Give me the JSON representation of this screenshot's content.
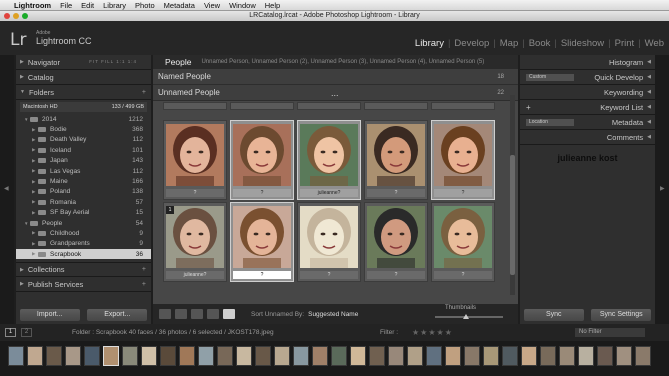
{
  "menubar": {
    "items": [
      "Lightroom",
      "File",
      "Edit",
      "Library",
      "Photo",
      "Metadata",
      "View",
      "Window",
      "Help"
    ]
  },
  "window": {
    "title": "LRCatalog.lrcat - Adobe Photoshop Lightroom - Library"
  },
  "identity": {
    "logo": "Lr",
    "adobe": "Adobe",
    "product": "Lightroom CC"
  },
  "modules": [
    "Library",
    "Develop",
    "Map",
    "Book",
    "Slideshow",
    "Print",
    "Web"
  ],
  "left_panel": {
    "navigator": {
      "label": "Navigator",
      "tools": "FIT FILL 1:1 1:4"
    },
    "catalog": {
      "label": "Catalog"
    },
    "folders": {
      "label": "Folders",
      "actions": "+",
      "volume": {
        "name": "Macintosh HD",
        "space": "133 / 499 GB"
      },
      "items": [
        {
          "name": "2014",
          "count": "1212",
          "depth": 1,
          "open": true
        },
        {
          "name": "Bodie",
          "count": "368",
          "depth": 2
        },
        {
          "name": "Death Valley",
          "count": "112",
          "depth": 2
        },
        {
          "name": "Iceland",
          "count": "101",
          "depth": 2
        },
        {
          "name": "Japan",
          "count": "143",
          "depth": 2
        },
        {
          "name": "Las Vegas",
          "count": "112",
          "depth": 2
        },
        {
          "name": "Maine",
          "count": "166",
          "depth": 2
        },
        {
          "name": "Poland",
          "count": "138",
          "depth": 2
        },
        {
          "name": "Romania",
          "count": "57",
          "depth": 2
        },
        {
          "name": "SF Bay Aerial",
          "count": "15",
          "depth": 2
        },
        {
          "name": "People",
          "count": "54",
          "depth": 1,
          "open": true
        },
        {
          "name": "Childhood",
          "count": "9",
          "depth": 2
        },
        {
          "name": "Grandparents",
          "count": "9",
          "depth": 2
        },
        {
          "name": "Scrapbook",
          "count": "36",
          "depth": 2,
          "selected": true
        }
      ]
    },
    "collections": {
      "label": "Collections",
      "actions": "+"
    },
    "publish": {
      "label": "Publish Services",
      "actions": "+"
    },
    "import_label": "Import...",
    "export_label": "Export..."
  },
  "center": {
    "people_title": "People",
    "people_breadcrumb": "Unnamed Person,  Unnamed Person (2),  Unnamed Person (3),  Unnamed Person (4),  Unnamed Person (5)",
    "named": {
      "label": "Named People",
      "count": "18"
    },
    "unnamed": {
      "label": "Unnamed People",
      "count": "22",
      "dots": "..."
    },
    "row1": [
      {
        "caption": "?",
        "selected": false,
        "palette": [
          "#b27a5e",
          "#5a2f22",
          "#e3b49b"
        ]
      },
      {
        "caption": "?",
        "selected": true,
        "palette": [
          "#a8705a",
          "#6c4a30",
          "#e8b496"
        ]
      },
      {
        "caption": "julieanne?",
        "selected": true,
        "palette": [
          "#5a7a5a",
          "#7a5a3a",
          "#efc4a4"
        ]
      },
      {
        "caption": "?",
        "selected": false,
        "palette": [
          "#aa9070",
          "#3a2a22",
          "#d39a7a"
        ]
      },
      {
        "caption": "?",
        "selected": true,
        "palette": [
          "#a48878",
          "#6a4020",
          "#e8b090"
        ]
      }
    ],
    "row2": [
      {
        "caption": "julieanne?",
        "selected": false,
        "badge": "1",
        "palette": [
          "#9a9a8a",
          "#6a5040",
          "#e0b8a0"
        ]
      },
      {
        "caption": "?",
        "selected": true,
        "edit": true,
        "palette": [
          "#c8a898",
          "#7a5030",
          "#e4b498"
        ]
      },
      {
        "caption": "?",
        "selected": false,
        "palette": [
          "#e4dcc6",
          "#c4b49c",
          "#f0e8d4"
        ]
      },
      {
        "caption": "?",
        "selected": false,
        "palette": [
          "#6a7a5a",
          "#2a2a2a",
          "#d09a80"
        ]
      },
      {
        "caption": "?",
        "selected": false,
        "palette": [
          "#6a8a6a",
          "#7a6040",
          "#e8bc9a"
        ]
      }
    ],
    "toolbar": {
      "sort_label": "Sort Unnamed By:",
      "sort_value": "Suggested Name",
      "thumbs_label": "Thumbnails",
      "thumbs_level": 0.45
    }
  },
  "right_panel": {
    "histogram": {
      "label": "Histogram"
    },
    "quick_develop": {
      "label": "Quick Develop",
      "preset": "Custom"
    },
    "keywording": {
      "label": "Keywording"
    },
    "keyword_list": {
      "label": "Keyword List",
      "actions": "+"
    },
    "metadata": {
      "label": "Metadata",
      "preset": "Location"
    },
    "comments": {
      "label": "Comments"
    },
    "watermark": "julieanne kost",
    "sync_label": "Sync",
    "sync_settings_label": "Sync Settings"
  },
  "filmstrip_bar": {
    "screen1": "1",
    "screen2": "2",
    "breadcrumb": "Folder : Scrapbook     40 faces / 36 photos / 6 selected / JKOST178.jpeg",
    "filter_label": "Filter :",
    "stars": "★★★★★",
    "filter_value": "No Filter"
  },
  "filmstrip": {
    "thumbs": [
      "#7b8c9a",
      "#c0a890",
      "#6a5a4a",
      "#a89888",
      "#4a5a6a",
      "#b09070",
      "#8a8a7a",
      "#d0c0a8",
      "#5a4a3a",
      "#a07858",
      "#90a0a8",
      "#786858",
      "#c8b8a0",
      "#685848",
      "#b8a890",
      "#8898a0",
      "#a08068",
      "#5a6a5a",
      "#d0b898",
      "#706050",
      "#98887a",
      "#b0a088",
      "#607080",
      "#c0a080",
      "#887868",
      "#a89878",
      "#505a60",
      "#c8a888",
      "#786a5a",
      "#9a8a78",
      "#b8b0a0",
      "#6a5a50",
      "#a09080",
      "#8a7a6a"
    ],
    "selected_index": 5
  }
}
